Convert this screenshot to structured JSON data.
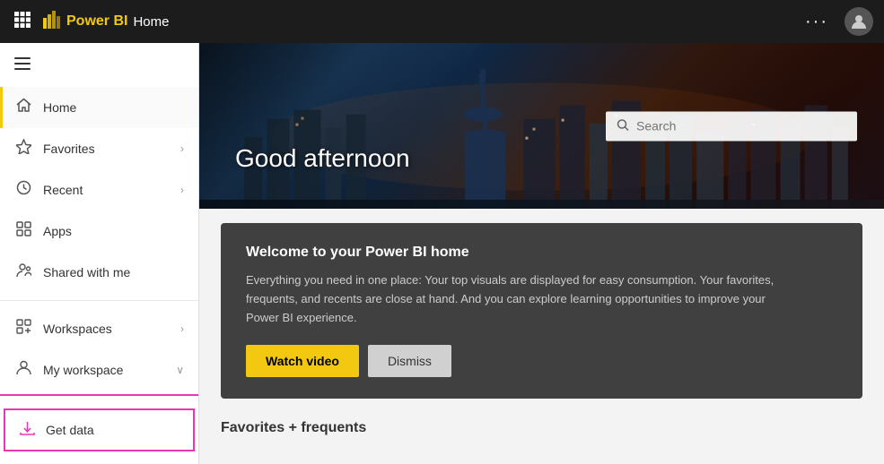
{
  "topbar": {
    "app_name": "Power BI",
    "page_title": "Home",
    "more_options_label": "···"
  },
  "sidebar": {
    "nav_items": [
      {
        "id": "home",
        "label": "Home",
        "icon": "home",
        "active": true,
        "has_chevron": false
      },
      {
        "id": "favorites",
        "label": "Favorites",
        "icon": "star",
        "active": false,
        "has_chevron": true
      },
      {
        "id": "recent",
        "label": "Recent",
        "icon": "clock",
        "active": false,
        "has_chevron": true
      },
      {
        "id": "apps",
        "label": "Apps",
        "icon": "grid",
        "active": false,
        "has_chevron": false
      },
      {
        "id": "shared",
        "label": "Shared with me",
        "icon": "person-share",
        "active": false,
        "has_chevron": false
      }
    ],
    "bottom_items": [
      {
        "id": "workspaces",
        "label": "Workspaces",
        "icon": "workspaces",
        "has_chevron": true
      },
      {
        "id": "my-workspace",
        "label": "My workspace",
        "icon": "person-workspace",
        "has_chevron": true,
        "expanded": true
      }
    ],
    "get_data_label": "Get data"
  },
  "hero": {
    "greeting": "Good afternoon",
    "search_placeholder": "Search"
  },
  "welcome_card": {
    "title": "Welcome to your Power BI home",
    "body": "Everything you need in one place: Your top visuals are displayed for easy consumption. Your favorites, frequents, and recents are close at hand. And you can explore learning opportunities to improve your Power BI experience.",
    "watch_video_label": "Watch video",
    "dismiss_label": "Dismiss"
  },
  "sections": {
    "favorites_title": "Favorites + frequents"
  }
}
